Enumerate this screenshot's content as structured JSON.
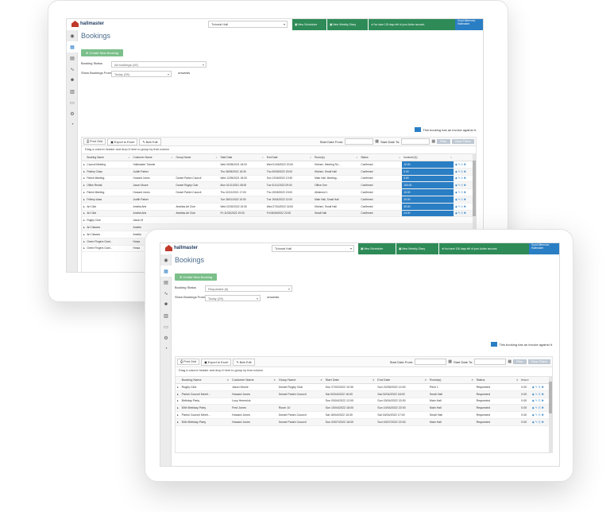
{
  "app": {
    "brand": "hallmaster",
    "venue": "Tutorial Hall",
    "toolbar_buttons": [
      "View Scheduler",
      "View Weekly Diary",
      "You have 126 days left of your Active account."
    ],
    "user": [
      "Good Afternoon,",
      "Hallmaster"
    ],
    "page_title": "Bookings",
    "create_label": "Create New Booking",
    "legend_text": "This booking has an invoice against it.",
    "grid_buttons": [
      "Print Grid",
      "Export to Excel",
      "Bulk Edit"
    ],
    "start_from_label": "Start Date From:",
    "start_to_label": "Start Date To:",
    "filter_label": "Filter",
    "clear_filters_label": "Clear Filters",
    "group_hint": "Drag a column header and drop it here to group by that column",
    "onwards": "onwards",
    "accent": "#2a7ec4",
    "green": "#2e8b57"
  },
  "back": {
    "status_label": "Booking Status",
    "status_value": "All bookings (28)",
    "show_label": "Show Bookings From",
    "show_value": "Today (28)",
    "columns": [
      "Booking Name",
      "Customer Name",
      "Group Name",
      "Start Date",
      "End Date",
      "Room(s)",
      "Status",
      "Invoiced (£)"
    ],
    "rows": [
      [
        "Council Meeting",
        "Hallmaster Tutorial",
        "",
        "Wed 05/05/2021 18:00",
        "Wed 01/06/2022 20:00",
        "Kitchen, Meeting Ro...",
        "Confirmed",
        "12.00"
      ],
      [
        "Pottery Class",
        "Judith Parker",
        "",
        "Thu 06/05/2021 18:30",
        "Thu 05/05/2022 20:00",
        "Kitchen, Small Hall",
        "Confirmed",
        "0.00"
      ],
      [
        "Parish Meeting",
        "Howard Jones",
        "Dorset Parish Council",
        "Wed 12/05/2021 18:00",
        "Sun 12/06/2022 19:30",
        "Main Hall, Meeting...",
        "Confirmed",
        "5.60"
      ],
      [
        "Office Rental",
        "Jason Moore",
        "Dorset Rugby Club",
        "Mon 01/11/2021 08:00",
        "Tue 01/11/2022 09:00",
        "Office One",
        "Confirmed",
        "100.00"
      ],
      [
        "Parish Meeting",
        "Howard Jones",
        "Dorset Parish Council",
        "Thu 02/12/2021 17:00",
        "Thu 19/05/2022 19:00",
        "Allotment 1",
        "Confirmed",
        "19.00"
      ],
      [
        "Pottery class",
        "Judith Parker",
        "",
        "Tue 25/01/2022 10:00",
        "Tue 19/04/2022 12:00",
        "Main Hall, Small Hall",
        "Confirmed",
        "20.00"
      ],
      [
        "Art Club",
        "Amelia Arts",
        "Amelias Art Club",
        "Wed 02/02/2022 15:30",
        "Wed 27/04/2022 16:00",
        "Kitchen, Small Hall",
        "Confirmed",
        "30.00"
      ],
      [
        "Art Club",
        "Amelia Arts",
        "Amelias Art Club",
        "Fri 11/02/2022 19:00",
        "Fri 06/05/2022 22:00",
        "Small Hall",
        "Confirmed",
        "24.00"
      ],
      [
        "Rugby Club",
        "Jason M",
        "",
        "",
        "",
        "",
        "",
        ""
      ],
      [
        "Art Classes",
        "Amelia",
        "",
        "",
        "",
        "",
        "",
        ""
      ],
      [
        "Art Classes",
        "Amelia",
        "",
        "",
        "",
        "",
        "",
        ""
      ],
      [
        "Green Fingers Gard...",
        "Howa",
        "",
        "",
        "",
        "",
        "",
        ""
      ],
      [
        "Green Fingers Gard...",
        "Howa",
        "",
        "",
        "",
        "",
        "",
        ""
      ]
    ]
  },
  "front": {
    "status_label": "Booking Status",
    "status_value": "Requested (6)",
    "show_label": "Show Bookings From",
    "show_value": "Today (28)",
    "columns": [
      "Booking Name",
      "Customer Name",
      "Group Name",
      "Start Date",
      "End Date",
      "Room(s)",
      "Status",
      "Invo"
    ],
    "rows": [
      [
        "Rugby Club",
        "Jason Moore",
        "Dorset Rugby Club",
        "Sun 27/02/2022 10:30",
        "Sun 22/05/2022 14:00",
        "Pitch 1",
        "Requested",
        "0.00"
      ],
      [
        "Parish Council Meeti...",
        "Howard Jones",
        "Dorset Parish Council",
        "Sat 02/04/2022 16:00",
        "Sat 02/04/2022 18:00",
        "Small Hall",
        "Requested",
        "0.00"
      ],
      [
        "Birthday Party",
        "Lucy Hemmick",
        "",
        "Sun 03/04/2022 12:00",
        "Sun 03/04/2022 15:30",
        "Main Hall",
        "Requested",
        "0.00"
      ],
      [
        "50th Birthday Party",
        "Fred Jones",
        "Room 10",
        "Sun 10/04/2022 18:00",
        "Sun 10/04/2022 22:00",
        "Main Hall",
        "Requested",
        "0.00"
      ],
      [
        "Parish Council Meeti...",
        "Howard Jones",
        "Dorset Parish Council",
        "Sat 16/04/2022 15:30",
        "Sat 16/04/2022 17:00",
        "Small Hall",
        "Requested",
        "0.00"
      ],
      [
        "50th Birthday Party",
        "Howard Jones",
        "Dorset Parish Council",
        "Sun 03/07/2022 18:00",
        "Sun 03/07/2022 22:00",
        "Main Hall",
        "Requested",
        "0.00"
      ]
    ]
  }
}
